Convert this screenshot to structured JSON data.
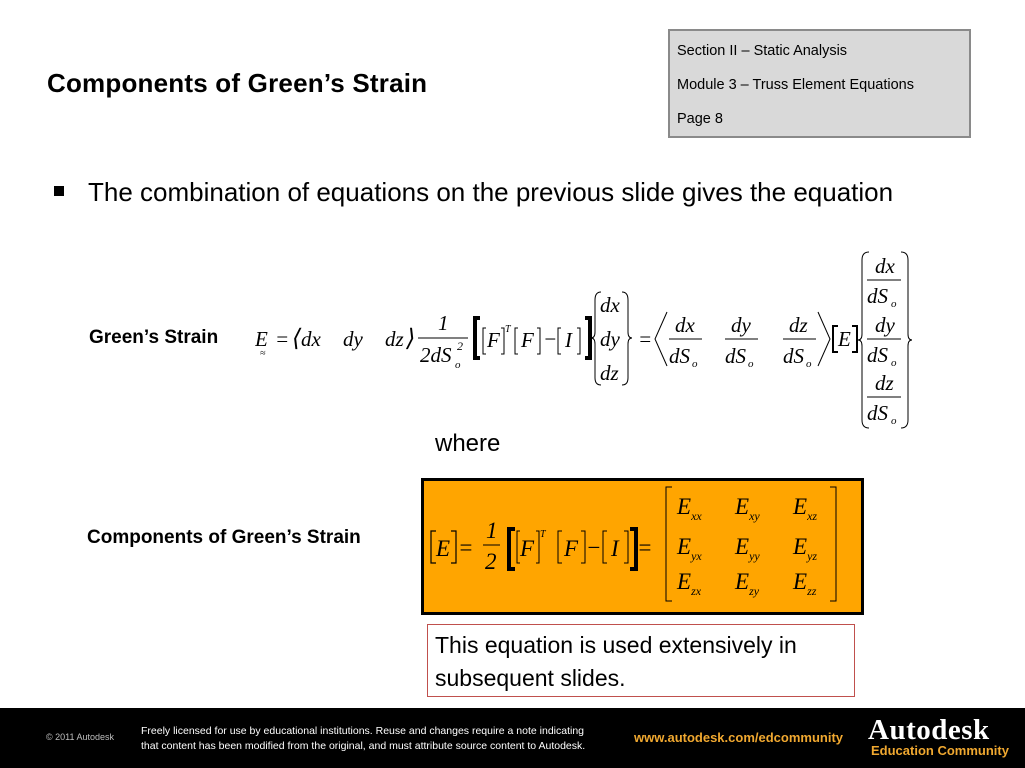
{
  "header": {
    "title": "Components of Green’s Strain",
    "info_box": {
      "section": "Section II – Static Analysis",
      "module": "Module 3 – Truss Element Equations",
      "page": "Page 8"
    }
  },
  "body": {
    "bullet": "The combination of equations on the previous slide gives the equation",
    "label_green_strain": "Green’s Strain",
    "where": "where",
    "label_components": "Components of Green’s Strain",
    "note": "This equation is used extensively in subsequent slides."
  },
  "equation1": {
    "lhs": "E",
    "row_vector": [
      "dx",
      "dy",
      "dz"
    ],
    "frac_num": "1",
    "frac_den": "2dS",
    "frac_den_sup": "2",
    "frac_den_sub": "o",
    "F": "F",
    "T": "T",
    "I": "I",
    "col_vector": [
      "dx",
      "dy",
      "dz"
    ],
    "norm_num": [
      "dx",
      "dy",
      "dz"
    ],
    "norm_den": "dS",
    "norm_den_sub": "o",
    "E_mat": "E",
    "eq": "=",
    "minus": "−"
  },
  "equation2": {
    "lhs": "E",
    "half_num": "1",
    "half_den": "2",
    "F": "F",
    "T": "T",
    "I": "I",
    "eq": "=",
    "minus": "−",
    "matrix": [
      [
        {
          "base": "E",
          "sub": "xx"
        },
        {
          "base": "E",
          "sub": "xy"
        },
        {
          "base": "E",
          "sub": "xz"
        }
      ],
      [
        {
          "base": "E",
          "sub": "yx"
        },
        {
          "base": "E",
          "sub": "yy"
        },
        {
          "base": "E",
          "sub": "yz"
        }
      ],
      [
        {
          "base": "E",
          "sub": "zx"
        },
        {
          "base": "E",
          "sub": "zy"
        },
        {
          "base": "E",
          "sub": "zz"
        }
      ]
    ],
    "box_color": "#ffa500"
  },
  "footer": {
    "copyright": "© 2011 Autodesk",
    "license_line1": "Freely licensed for use by educational institutions. Reuse and changes require a note indicating",
    "license_line2": "that content has been modified from the original, and must attribute source content to Autodesk.",
    "url": "www.autodesk.com/edcommunity",
    "brand": "Autodesk",
    "brand_sub": "Education Community",
    "accent_color": "#f0a830"
  }
}
